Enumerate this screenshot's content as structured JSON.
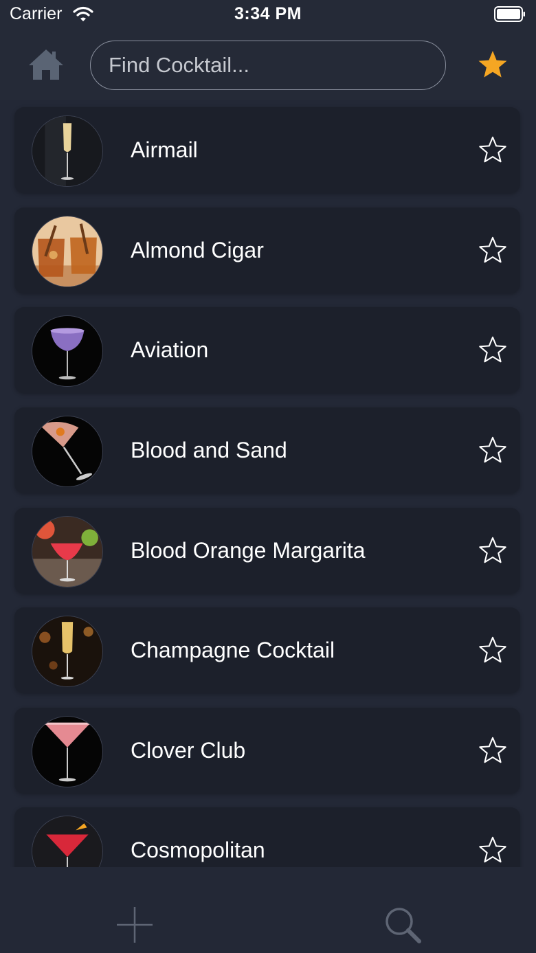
{
  "status_bar": {
    "carrier": "Carrier",
    "time": "3:34 PM"
  },
  "header": {
    "home_icon": "home-icon",
    "search": {
      "placeholder": "Find Cocktail...",
      "value": ""
    },
    "favorites_icon": "star-filled-icon",
    "accent_color": "#f5a623"
  },
  "cocktails": [
    {
      "name": "Airmail",
      "favorite": false
    },
    {
      "name": "Almond Cigar",
      "favorite": false
    },
    {
      "name": "Aviation",
      "favorite": false
    },
    {
      "name": "Blood and Sand",
      "favorite": false
    },
    {
      "name": "Blood Orange Margarita",
      "favorite": false
    },
    {
      "name": "Champagne Cocktail",
      "favorite": false
    },
    {
      "name": "Clover Club",
      "favorite": false
    },
    {
      "name": "Cosmopolitan",
      "favorite": false
    }
  ],
  "tab_bar": {
    "add_icon": "plus-icon",
    "search_icon": "magnifier-icon"
  }
}
